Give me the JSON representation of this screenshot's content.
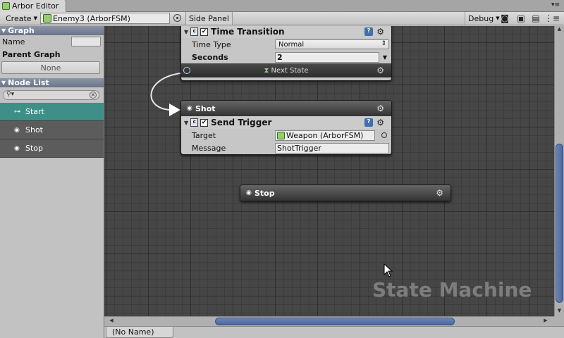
{
  "window": {
    "title": "Arbor Editor"
  },
  "toolbar": {
    "create_label": "Create",
    "graph_name": "Enemy3 (ArborFSM)",
    "side_panel_label": "Side Panel",
    "debug_label": "Debug"
  },
  "side_panel": {
    "graph_section": {
      "header": "Graph",
      "name_label": "Name",
      "name_value": "",
      "parent_graph_label": "Parent Graph",
      "parent_graph_value": "None"
    },
    "node_list": {
      "header": "Node List",
      "search_placeholder": "",
      "items": [
        {
          "label": "Start",
          "selected": true
        },
        {
          "label": "Shot",
          "selected": false
        },
        {
          "label": "Stop",
          "selected": false
        }
      ]
    }
  },
  "canvas": {
    "watermark": "State Machine",
    "nodes": {
      "start": {
        "behaviour": {
          "title": "Time Transition",
          "time_type_label": "Time Type",
          "time_type_value": "Normal",
          "seconds_label": "Seconds",
          "seconds_value": "2"
        },
        "transition_label": "Next State"
      },
      "shot": {
        "title": "Shot",
        "behaviour": {
          "title": "Send Trigger",
          "target_label": "Target",
          "target_value": "Weapon (ArborFSM)",
          "message_label": "Message",
          "message_value": "ShotTrigger"
        }
      },
      "stop": {
        "title": "Stop"
      }
    }
  },
  "status": {
    "tab_label": "(No Name)"
  },
  "colors": {
    "selected_node": "#3e8f88",
    "scroll_thumb": "#5b74a8",
    "canvas_bg": "#464646"
  }
}
